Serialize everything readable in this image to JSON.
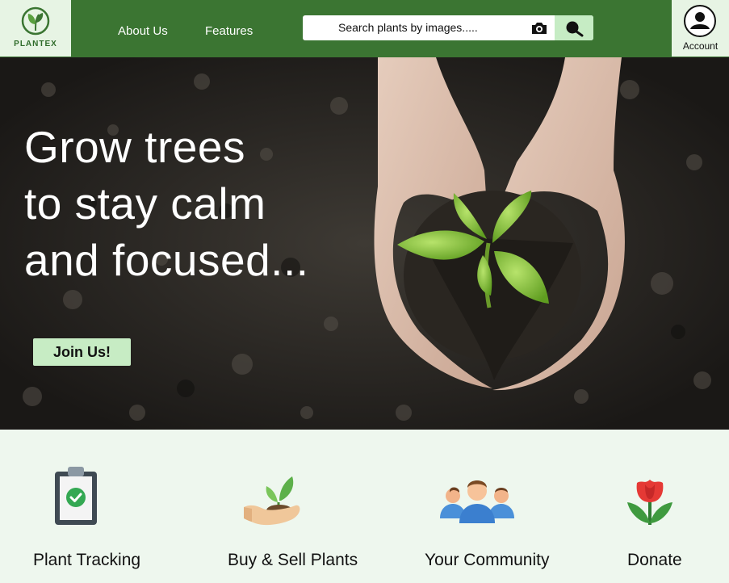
{
  "brand": {
    "name": "PLANTEX"
  },
  "nav": {
    "about": "About Us",
    "features": "Features"
  },
  "search": {
    "text": "Search plants by images....."
  },
  "account": {
    "label": "Account"
  },
  "hero": {
    "lines": [
      "Grow trees",
      "to stay calm",
      "and focused..."
    ],
    "cta": "Join Us!"
  },
  "features": [
    {
      "label": "Plant Tracking",
      "icon": "clipboard-check-icon"
    },
    {
      "label": "Buy & Sell Plants",
      "icon": "hand-seedling-icon"
    },
    {
      "label": "Your Community",
      "icon": "community-people-icon"
    },
    {
      "label": "Donate",
      "icon": "tulip-icon"
    }
  ],
  "colors": {
    "header": "#3b7532",
    "accent": "#c7ecc4",
    "background": "#eef7ee"
  }
}
